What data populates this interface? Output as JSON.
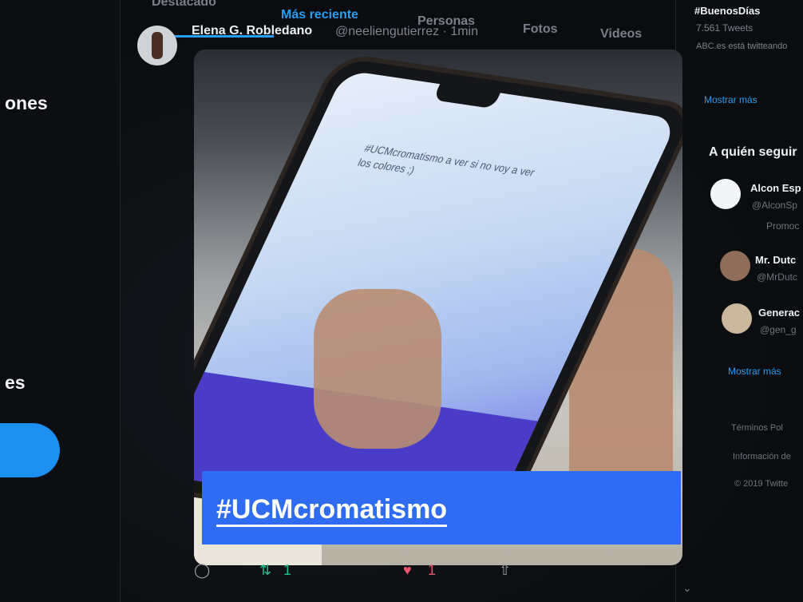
{
  "left_nav": {
    "item_1": "ones",
    "item_2": "es"
  },
  "tabs": [
    {
      "label": "Destacado"
    },
    {
      "label": "Más reciente"
    },
    {
      "label": "Personas"
    },
    {
      "label": "Fotos"
    },
    {
      "label": "Videos"
    }
  ],
  "tweet": {
    "author": "Elena G. Robledano",
    "handle": "@neeliengutierrez · 1min",
    "phone_text": "#UCMcromatismo a ver si no voy a ver los colores ;)",
    "hashtag": "#UCMcromatismo",
    "retweets": "1",
    "likes": "1"
  },
  "right": {
    "trend_title": "#BuenosDías",
    "trend_count": "7.561 Tweets",
    "trend_meta": "ABC.es está twitteando",
    "show_more_1": "Mostrar más",
    "follow_title": "A quién seguir",
    "accounts": [
      {
        "name": "Alcon Esp",
        "handle": "@AlconSp",
        "extra": "Promoc"
      },
      {
        "name": "Mr. Dutc",
        "handle": "@MrDutc"
      },
      {
        "name": "Generac",
        "handle": "@gen_g"
      }
    ],
    "show_more_2": "Mostrar más",
    "footer_1": "Términos   Pol",
    "footer_2": "Información de",
    "footer_3": "© 2019 Twitte"
  },
  "colors": {
    "accent": "#2a9df4",
    "retweet": "#19c28b",
    "like": "#f2536e",
    "banner": "#2f6cf1"
  },
  "icons": [
    "reply-icon",
    "retweet-icon",
    "like-icon",
    "share-icon"
  ]
}
